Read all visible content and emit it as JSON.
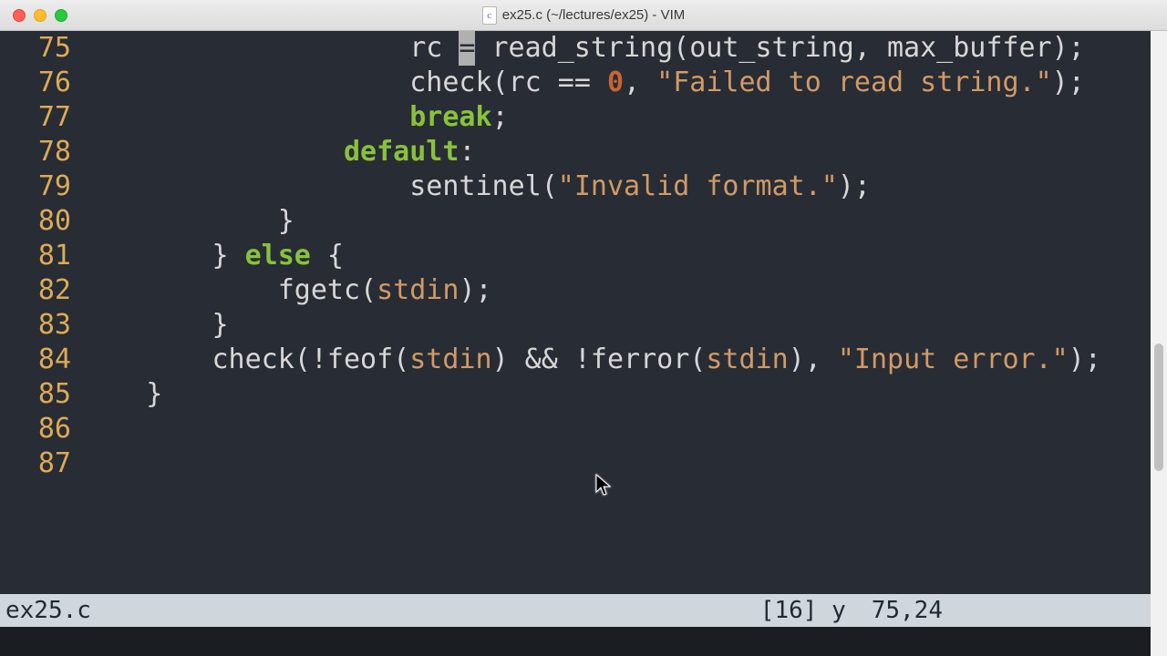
{
  "window": {
    "title": "ex25.c (~/lectures/ex25) - VIM",
    "doc_icon_letter": "c"
  },
  "code": {
    "lines": [
      {
        "num": "75",
        "tokens": [
          {
            "t": "plain",
            "v": "                    rc "
          },
          {
            "t": "cursor",
            "v": "="
          },
          {
            "t": "plain",
            "v": " read_string(out_string, max_buffer);"
          }
        ]
      },
      {
        "num": "76",
        "tokens": [
          {
            "t": "plain",
            "v": "                    check(rc == "
          },
          {
            "t": "number",
            "v": "0"
          },
          {
            "t": "plain",
            "v": ", "
          },
          {
            "t": "string",
            "v": "\"Failed to read string.\""
          },
          {
            "t": "plain",
            "v": ");"
          }
        ]
      },
      {
        "num": "77",
        "tokens": [
          {
            "t": "plain",
            "v": "                    "
          },
          {
            "t": "keyword",
            "v": "break"
          },
          {
            "t": "plain",
            "v": ";"
          }
        ]
      },
      {
        "num": "78",
        "tokens": [
          {
            "t": "plain",
            "v": ""
          }
        ]
      },
      {
        "num": "79",
        "tokens": [
          {
            "t": "plain",
            "v": "                "
          },
          {
            "t": "keyword",
            "v": "default"
          },
          {
            "t": "plain",
            "v": ":"
          }
        ]
      },
      {
        "num": "80",
        "tokens": [
          {
            "t": "plain",
            "v": "                    sentinel("
          },
          {
            "t": "string",
            "v": "\"Invalid format.\""
          },
          {
            "t": "plain",
            "v": ");"
          }
        ]
      },
      {
        "num": "81",
        "tokens": [
          {
            "t": "plain",
            "v": "            }"
          }
        ]
      },
      {
        "num": "82",
        "tokens": [
          {
            "t": "plain",
            "v": "        } "
          },
          {
            "t": "keyword",
            "v": "else"
          },
          {
            "t": "plain",
            "v": " {"
          }
        ]
      },
      {
        "num": "83",
        "tokens": [
          {
            "t": "plain",
            "v": "            fgetc("
          },
          {
            "t": "const",
            "v": "stdin"
          },
          {
            "t": "plain",
            "v": ");"
          }
        ]
      },
      {
        "num": "84",
        "tokens": [
          {
            "t": "plain",
            "v": "        }"
          }
        ]
      },
      {
        "num": "85",
        "tokens": [
          {
            "t": "plain",
            "v": ""
          }
        ]
      },
      {
        "num": "86",
        "tokens": [
          {
            "t": "plain",
            "v": "        check(!feof("
          },
          {
            "t": "const",
            "v": "stdin"
          },
          {
            "t": "plain",
            "v": ") && !ferror("
          },
          {
            "t": "const",
            "v": "stdin"
          },
          {
            "t": "plain",
            "v": "), "
          },
          {
            "t": "string",
            "v": "\"Input error.\""
          },
          {
            "t": "plain",
            "v": ");"
          }
        ]
      },
      {
        "num": "87",
        "tokens": [
          {
            "t": "plain",
            "v": "    }"
          }
        ]
      }
    ]
  },
  "statusline": {
    "filename": "ex25.c",
    "register": "[16] y",
    "position": "75,24"
  }
}
